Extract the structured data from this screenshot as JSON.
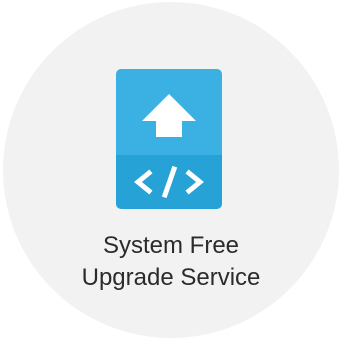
{
  "app": {
    "name_line1": "System Free",
    "name_line2": "Upgrade Service",
    "icon": "upgrade-code-icon",
    "code_symbol": "</>",
    "colors": {
      "tile_background": "#f2f2f2",
      "icon_top": "#3ab1e2",
      "icon_bottom": "#27a2d6",
      "icon_glyph": "#ffffff",
      "label_text": "#2b2b2b"
    }
  }
}
